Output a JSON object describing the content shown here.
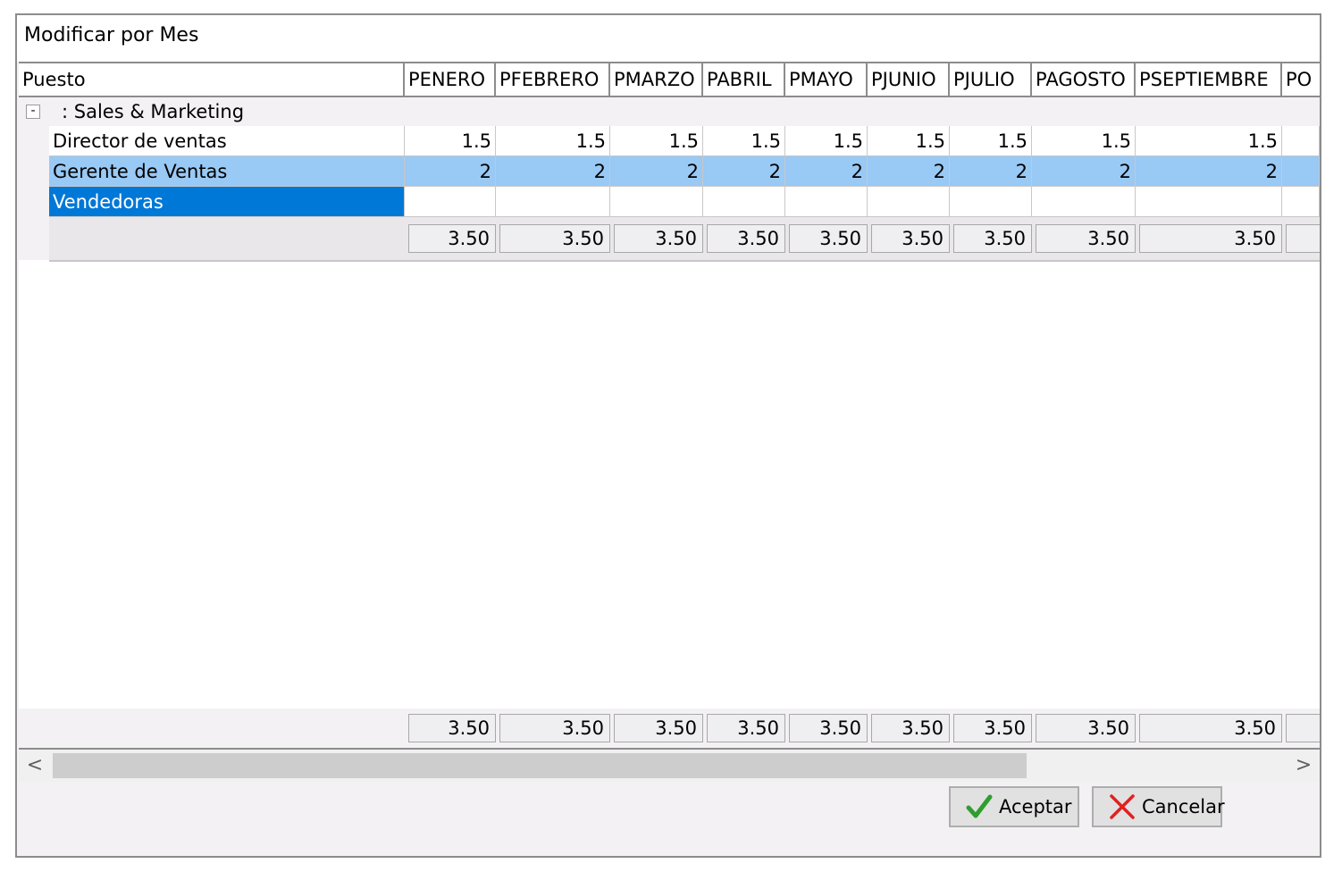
{
  "window": {
    "title": "Modificar por Mes"
  },
  "grid": {
    "columns": [
      "Puesto",
      "PENERO",
      "PFEBRERO",
      "PMARZO",
      "PABRIL",
      "PMAYO",
      "PJUNIO",
      "PJULIO",
      "PAGOSTO",
      "PSEPTIEMBRE",
      "PO"
    ],
    "group": {
      "toggle": "-",
      "label": ": Sales & Marketing"
    },
    "rows": [
      {
        "name": "Director de ventas",
        "values": [
          "1.5",
          "1.5",
          "1.5",
          "1.5",
          "1.5",
          "1.5",
          "1.5",
          "1.5",
          "1.5",
          ""
        ]
      },
      {
        "name": "Gerente de Ventas",
        "values": [
          "2",
          "2",
          "2",
          "2",
          "2",
          "2",
          "2",
          "2",
          "2",
          ""
        ]
      },
      {
        "name": "Vendedoras",
        "values": [
          "",
          "",
          "",
          "",
          "",
          "",
          "",
          "",
          "",
          ""
        ]
      }
    ],
    "group_totals": [
      "3.50",
      "3.50",
      "3.50",
      "3.50",
      "3.50",
      "3.50",
      "3.50",
      "3.50",
      "3.50",
      ""
    ],
    "grand_totals": [
      "3.50",
      "3.50",
      "3.50",
      "3.50",
      "3.50",
      "3.50",
      "3.50",
      "3.50",
      "3.50",
      ""
    ]
  },
  "scrollbar": {
    "left_arrow": "<",
    "right_arrow": ">"
  },
  "buttons": {
    "ok": {
      "label": "Aceptar",
      "icon": "checkmark-icon",
      "color": "#2e9e2e"
    },
    "cancel": {
      "label": "Cancelar",
      "icon": "x-icon",
      "color": "#e02020"
    }
  }
}
